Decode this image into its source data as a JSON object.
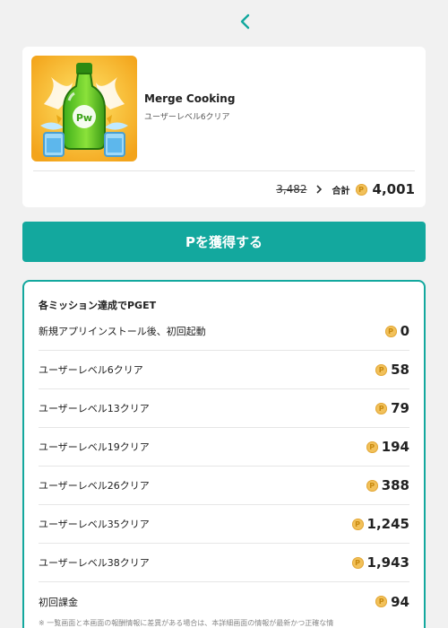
{
  "nav": {
    "back_icon": "chevron-left-icon"
  },
  "app": {
    "name": "Merge Cooking",
    "subtitle": "ユーザーレベル6クリア",
    "icon": "green-bottle-app-icon"
  },
  "points": {
    "old_value": "3,482",
    "total_label": "合計",
    "total_value": "4,001",
    "coin_symbol": "P"
  },
  "cta": {
    "label": "Pを獲得する"
  },
  "missions": {
    "title": "各ミッション達成でPGET",
    "items": [
      {
        "label": "新規アプリインストール後、初回起動",
        "points": "0"
      },
      {
        "label": "ユーザーレベル6クリア",
        "points": "58"
      },
      {
        "label": "ユーザーレベル13クリア",
        "points": "79"
      },
      {
        "label": "ユーザーレベル19クリア",
        "points": "194"
      },
      {
        "label": "ユーザーレベル26クリア",
        "points": "388"
      },
      {
        "label": "ユーザーレベル35クリア",
        "points": "1,245"
      },
      {
        "label": "ユーザーレベル38クリア",
        "points": "1,943"
      },
      {
        "label": "初回課金",
        "points": "94"
      }
    ],
    "footnote": "※ 一覧画面と本画面の報酬情報に差異がある場合は、本詳細画面の情報が最新かつ正確な情"
  },
  "colors": {
    "accent": "#13a89e",
    "coin": "#f2c15a"
  }
}
